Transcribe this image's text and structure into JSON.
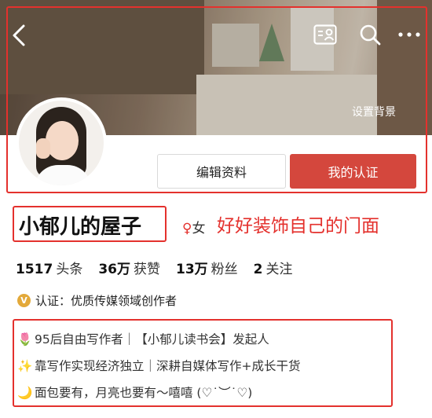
{
  "header": {
    "back_icon": "chevron-left-icon",
    "card_icon": "contact-card-icon",
    "search_icon": "search-icon",
    "more_icon": "more-icon",
    "set_background": "设置背景"
  },
  "profile": {
    "edit_label": "编辑资料",
    "cert_label": "我的认证",
    "name": "小郁儿的屋子",
    "gender_symbol": "♀",
    "gender_text": "女",
    "tagline": "好好装饰自己的门面"
  },
  "stats": [
    {
      "num": "1517",
      "label": "头条"
    },
    {
      "num": "36万",
      "label": "获赞"
    },
    {
      "num": "13万",
      "label": "粉丝"
    },
    {
      "num": "2",
      "label": "关注"
    }
  ],
  "certification": {
    "badge": "V",
    "text": "认证：优质传媒领域创作者"
  },
  "bio": [
    {
      "emoji": "🌷",
      "text": "95后自由写作者｜【小郁儿读书会】发起人"
    },
    {
      "emoji": "✨",
      "text": "靠写作实现经济独立｜深耕自媒体写作+成长干货"
    },
    {
      "emoji": "🌙",
      "text": "面包要有，月亮也要有～嘻嘻 (♡˙︶˙♡)"
    }
  ],
  "colors": {
    "accent": "#e4312d",
    "cert_button": "#d4473d"
  }
}
